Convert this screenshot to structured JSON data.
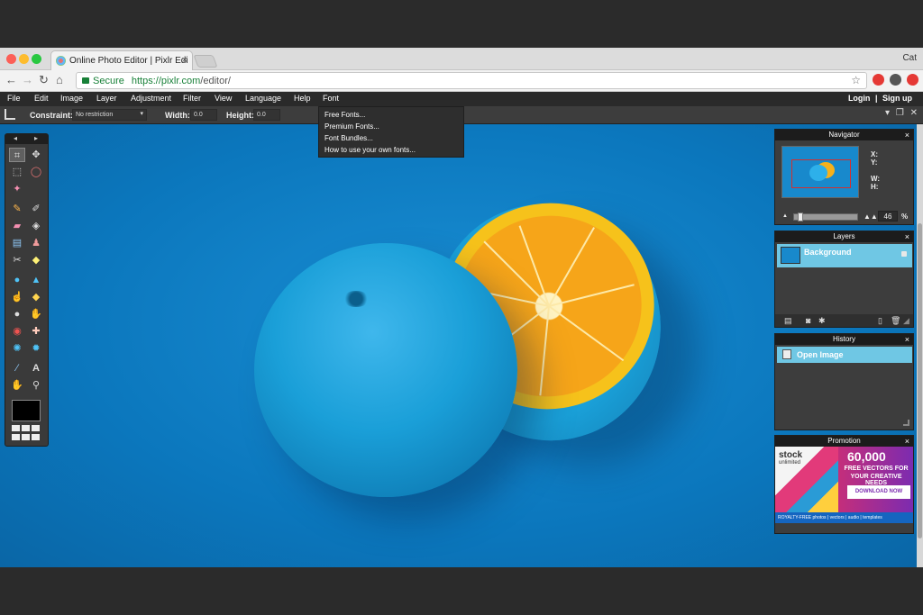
{
  "browser": {
    "tab_title": "Online Photo Editor | Pixlr Edi",
    "tab_close": "×",
    "profile_name": "Cat",
    "url_secure_label": "Secure",
    "url_host": "https://pixlr.com",
    "url_path": "/editor/"
  },
  "menubar": {
    "items": [
      "File",
      "Edit",
      "Image",
      "Layer",
      "Adjustment",
      "Filter",
      "View",
      "Language",
      "Help",
      "Font"
    ],
    "login": "Login",
    "separator": "|",
    "signup": "Sign up"
  },
  "options_bar": {
    "constraint_label": "Constraint:",
    "constraint_value": "No restriction",
    "width_label": "Width:",
    "width_value": "0.0",
    "height_label": "Height:",
    "height_value": "0.0"
  },
  "font_menu": {
    "items": [
      "Free Fonts...",
      "Premium Fonts...",
      "Font Bundles...",
      "How to use your own fonts..."
    ]
  },
  "navigator": {
    "title": "Navigator",
    "close": "×",
    "x_label": "X:",
    "y_label": "Y:",
    "w_label": "W:",
    "h_label": "H:",
    "zoom_value": "46",
    "zoom_unit": "%"
  },
  "layers": {
    "title": "Layers",
    "close": "×",
    "items": [
      {
        "name": "Background"
      }
    ]
  },
  "history": {
    "title": "History",
    "close": "×",
    "items": [
      {
        "label": "Open Image"
      }
    ]
  },
  "promotion": {
    "title": "Promotion",
    "close": "×",
    "logo": "stock",
    "logo_sub": "unlimited",
    "count": "60,000",
    "line1": "FREE VECTORS FOR",
    "line2": "YOUR CREATIVE NEEDS",
    "button": "DOWNLOAD NOW",
    "footer": "ROYALTY-FREE  photos | vectors | audio | templates"
  },
  "colors": {
    "canvas_bg": "#0b77bd",
    "selection_row": "#6fc7e4",
    "menubar_bg": "#2a2a2a",
    "secure_green": "#188038"
  },
  "icons": {
    "tools": [
      "crop-icon",
      "move-icon",
      "marquee-icon",
      "lasso-icon",
      "wand-icon",
      "pencil-icon",
      "brush-icon",
      "eraser-icon",
      "bucket-icon",
      "gradient-icon",
      "stamp-icon",
      "color-replace-icon",
      "drawing-icon",
      "blur-icon",
      "sharpen-icon",
      "smudge-icon",
      "sponge-icon",
      "dodge-icon",
      "burn-icon",
      "red-eye-icon",
      "spot-heal-icon",
      "bloat-icon",
      "pinch-icon",
      "color-picker-icon",
      "type-icon",
      "hand-icon",
      "zoom-icon"
    ]
  }
}
